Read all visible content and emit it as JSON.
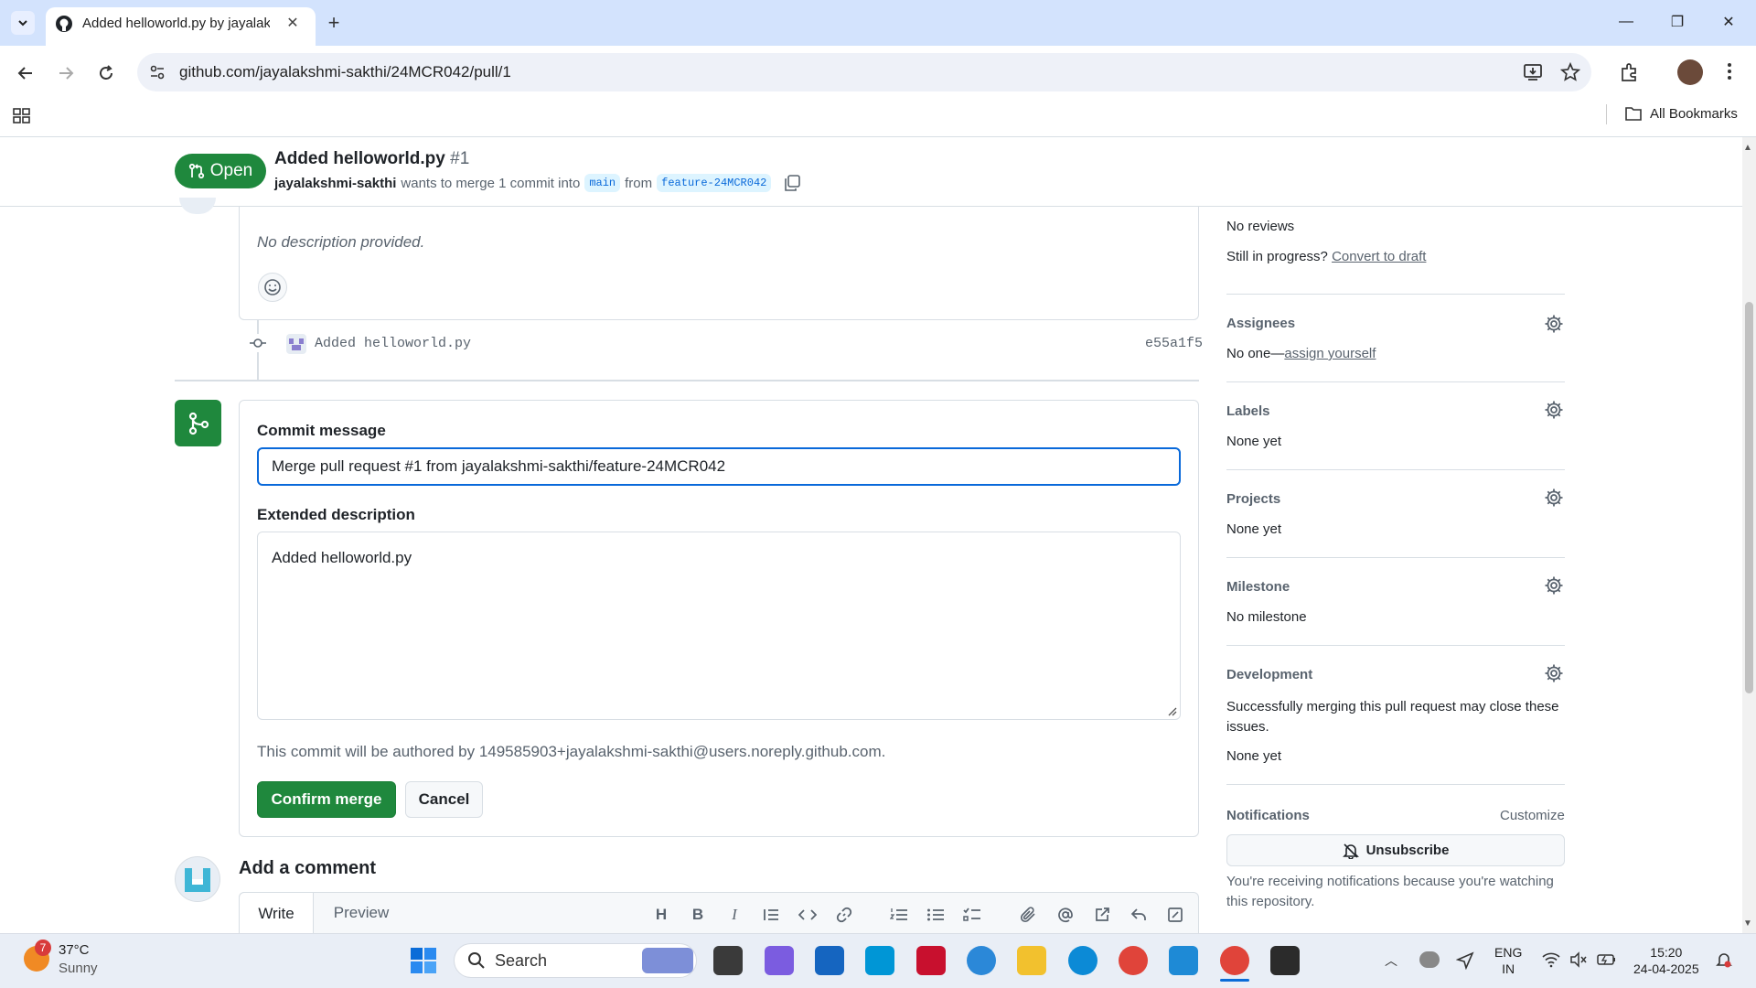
{
  "browser": {
    "tab_title": "Added helloworld.py by jayalakshmi-sakthi",
    "tab_close": "✕",
    "new_tab": "+",
    "url": "github.com/jayalakshmi-sakthi/24MCR042/pull/1",
    "all_bookmarks": "All Bookmarks",
    "window_min": "—",
    "window_restore": "❐",
    "window_close": "✕"
  },
  "pr": {
    "state": "Open",
    "title": "Added helloworld.py",
    "number": "#1",
    "author": "jayalakshmi-sakthi",
    "merge_text": "wants to merge 1 commit into",
    "base_branch": "main",
    "from_text": "from",
    "head_branch": "feature-24MCR042"
  },
  "timeline": {
    "description": "No description provided.",
    "commit_message": "Added helloworld.py",
    "commit_sha": "e55a1f5"
  },
  "merge_form": {
    "commit_label": "Commit message",
    "commit_value": "Merge pull request #1 from jayalakshmi-sakthi/feature-24MCR042",
    "ext_label": "Extended description",
    "ext_value": "Added helloworld.py",
    "author_note": "This commit will be authored by 149585903+jayalakshmi-sakthi@users.noreply.github.com.",
    "confirm_label": "Confirm merge",
    "cancel_label": "Cancel"
  },
  "comment": {
    "heading": "Add a comment",
    "write_tab": "Write",
    "preview_tab": "Preview",
    "heading_btn": "H",
    "bold_btn": "B",
    "italic_btn": "I"
  },
  "sidebar": {
    "reviews_value": "No reviews",
    "in_progress": "Still in progress?",
    "convert_draft": "Convert to draft",
    "assignees_head": "Assignees",
    "assignees_none": "No one—",
    "assign_yourself": "assign yourself",
    "labels_head": "Labels",
    "labels_value": "None yet",
    "projects_head": "Projects",
    "projects_value": "None yet",
    "milestone_head": "Milestone",
    "milestone_value": "No milestone",
    "development_head": "Development",
    "development_text": "Successfully merging this pull request may close these issues.",
    "development_value": "None yet",
    "notifications_head": "Notifications",
    "customize": "Customize",
    "unsubscribe": "Unsubscribe",
    "notify_text": "You're receiving notifications because you're watching this repository."
  },
  "taskbar": {
    "weather_badge": "7",
    "temperature": "37°C",
    "condition": "Sunny",
    "search": "Search",
    "lang_top": "ENG",
    "lang_bottom": "IN",
    "time": "15:20",
    "date": "24-04-2025"
  },
  "colors": {
    "open_green": "#1f883d",
    "link_blue": "#0969da",
    "tabbar": "#d3e3fd"
  }
}
